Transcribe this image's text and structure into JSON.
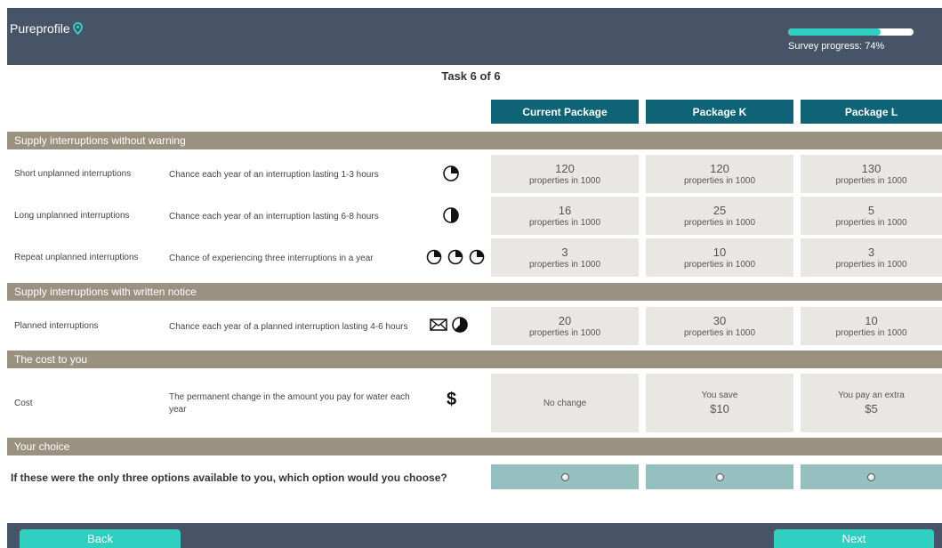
{
  "header": {
    "logo_text": "Pureprofile",
    "progress_label": "Survey progress: 74%",
    "progress_value": 0.74,
    "accent_color": "#2fcfc1",
    "bg_color": "#475366"
  },
  "task_title": "Task 6 of 6",
  "columns": [
    "Current Package",
    "Package K",
    "Package L"
  ],
  "sections": {
    "s1": "Supply interruptions without warning",
    "s2": "Supply interruptions with written notice",
    "s3": "The cost to you",
    "s4": "Your choice"
  },
  "rows": [
    {
      "label": "Short unplanned interruptions",
      "desc": "Chance each year of an interruption lasting 1-3 hours",
      "icon": "clock-quarter-icon",
      "cells": [
        {
          "num": "120",
          "unit": "properties in 1000"
        },
        {
          "num": "120",
          "unit": "properties in 1000"
        },
        {
          "num": "130",
          "unit": "properties in 1000"
        }
      ]
    },
    {
      "label": "Long unplanned interruptions",
      "desc": "Chance each year of an interruption lasting 6-8 hours",
      "icon": "clock-half-icon",
      "cells": [
        {
          "num": "16",
          "unit": "properties in 1000"
        },
        {
          "num": "25",
          "unit": "properties in 1000"
        },
        {
          "num": "5",
          "unit": "properties in 1000"
        }
      ]
    },
    {
      "label": "Repeat unplanned interruptions",
      "desc": "Chance of experiencing three interruptions in a year",
      "icon": "three-clocks-icon",
      "cells": [
        {
          "num": "3",
          "unit": "properties in 1000"
        },
        {
          "num": "10",
          "unit": "properties in 1000"
        },
        {
          "num": "3",
          "unit": "properties in 1000"
        }
      ]
    },
    {
      "label": "Planned interruptions",
      "desc": "Chance each year of a planned interruption lasting 4-6 hours",
      "icon": "envelope-clock-icon",
      "cells": [
        {
          "num": "20",
          "unit": "properties in 1000"
        },
        {
          "num": "30",
          "unit": "properties in 1000"
        },
        {
          "num": "10",
          "unit": "properties in 1000"
        }
      ]
    },
    {
      "label": "Cost",
      "desc_line1": "The permanent change in the amount you pay for water each",
      "desc_line2": "year",
      "icon": "dollar-icon",
      "icon_text": "$",
      "cells": [
        {
          "single": "No change"
        },
        {
          "top": "You save",
          "amt": "$10"
        },
        {
          "top": "You pay an extra",
          "amt": "$5"
        }
      ]
    }
  ],
  "question": "If these were the only three options available to you, which option would you choose?",
  "buttons": {
    "back": "Back",
    "next": "Next"
  }
}
